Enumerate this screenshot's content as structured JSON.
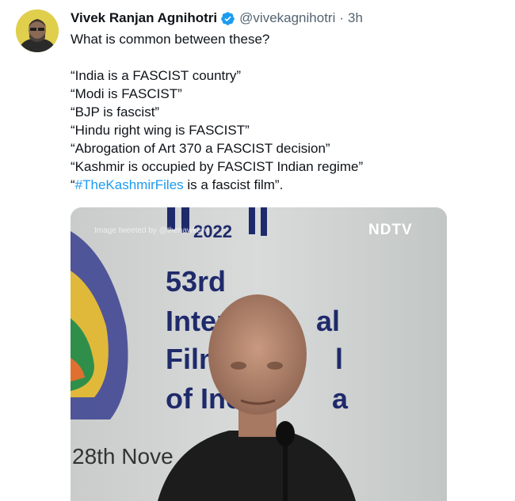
{
  "author": {
    "name": "Vivek Ranjan Agnihotri",
    "handle": "@vivekagnihotri",
    "separator": "·",
    "time": "3h"
  },
  "tweet": {
    "intro": "What is common between these?",
    "quotes": [
      "“India is a FASCIST country”",
      "“Modi is FASCIST”",
      "“BJP is fascist”",
      "“Hindu right wing is FASCIST”",
      "“Abrogation of Art 370 a FASCIST decision”",
      "“Kashmir is occupied by FASCIST Indian regime”"
    ],
    "last_quote_open": "“",
    "hashtag": "#TheKashmirFiles",
    "last_quote_rest": " is a fascist film”."
  },
  "media": {
    "watermark": "Image tweeted by @thehawkeye",
    "channel_logo": "NDTV",
    "banner_year": "2022",
    "banner_lines": [
      "53rd",
      "Intern",
      "al",
      "Film",
      "l",
      "of Inc",
      "a"
    ],
    "banner_date": "28th Nove"
  },
  "colors": {
    "verified_blue": "#1d9bf0",
    "link_blue": "#1d9bf0",
    "banner_text": "#1f2a6b"
  },
  "icons": {
    "verified": "verified-badge-icon"
  }
}
